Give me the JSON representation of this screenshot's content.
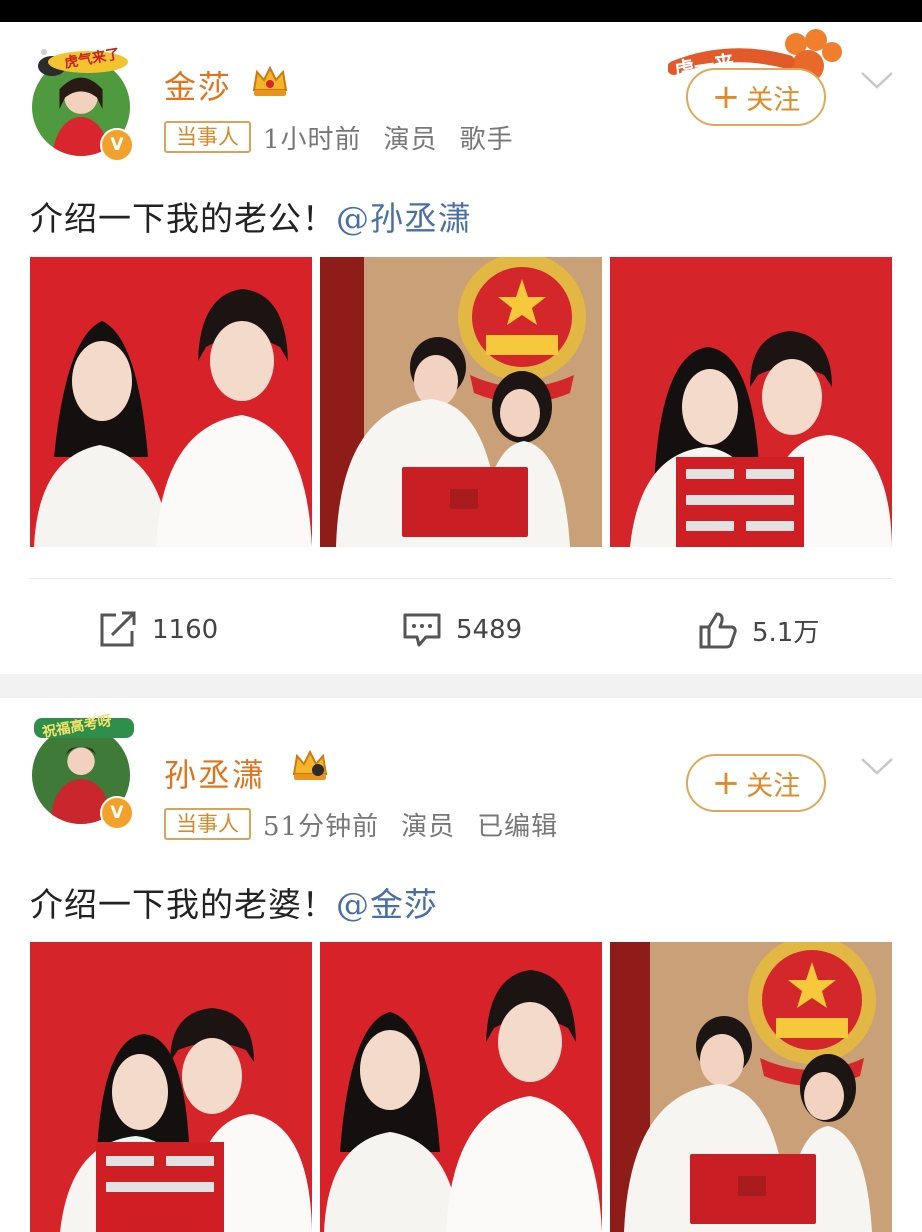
{
  "posts": [
    {
      "avatar_deco_text": "虎气来了",
      "name": "金莎",
      "tag": "当事人",
      "time": "1小时前",
      "role": "演员",
      "extra": "歌手",
      "follow_label": "关注",
      "text_prefix": "介绍一下我的老公！",
      "mention": "@孙丞潇",
      "reposts": "1160",
      "comments": "5489",
      "likes": "5.1万",
      "badge_text": "虎一来"
    },
    {
      "avatar_deco_text": "祝福高考呀",
      "name": "孙丞潇",
      "tag": "当事人",
      "time": "51分钟前",
      "role": "演员",
      "extra": "已编辑",
      "follow_label": "关注",
      "text_prefix": "介绍一下我的老婆！",
      "mention": "@金莎"
    }
  ],
  "colors": {
    "name": "#e0741c",
    "follow": "#e08a2a",
    "mention": "#4a6fa5",
    "photo_red": "#d8222a",
    "verify": "#f2a22b"
  },
  "icons": [
    "repost-icon",
    "comment-icon",
    "like-icon",
    "crown-icon",
    "chevron-down-icon",
    "verified-icon"
  ],
  "photos": {
    "post1": [
      "red-background-portrait",
      "emblem-certificate-photo",
      "red-background-xi-photo"
    ],
    "post2": [
      "red-background-xi-photo",
      "red-background-portrait",
      "emblem-certificate-photo"
    ]
  }
}
